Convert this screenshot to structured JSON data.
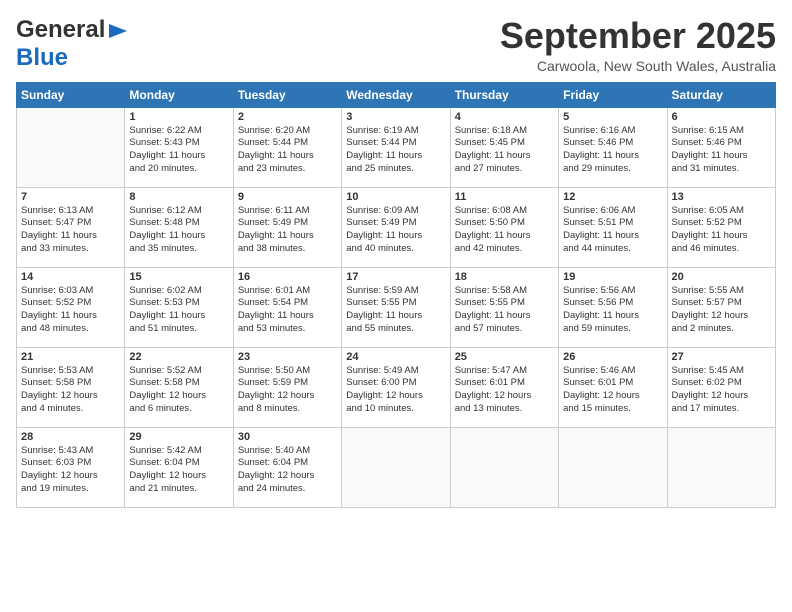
{
  "logo": {
    "line1": "General",
    "line2": "Blue"
  },
  "title": "September 2025",
  "subtitle": "Carwoola, New South Wales, Australia",
  "days": [
    "Sunday",
    "Monday",
    "Tuesday",
    "Wednesday",
    "Thursday",
    "Friday",
    "Saturday"
  ],
  "weeks": [
    [
      {
        "num": "",
        "lines": []
      },
      {
        "num": "1",
        "lines": [
          "Sunrise: 6:22 AM",
          "Sunset: 5:43 PM",
          "Daylight: 11 hours",
          "and 20 minutes."
        ]
      },
      {
        "num": "2",
        "lines": [
          "Sunrise: 6:20 AM",
          "Sunset: 5:44 PM",
          "Daylight: 11 hours",
          "and 23 minutes."
        ]
      },
      {
        "num": "3",
        "lines": [
          "Sunrise: 6:19 AM",
          "Sunset: 5:44 PM",
          "Daylight: 11 hours",
          "and 25 minutes."
        ]
      },
      {
        "num": "4",
        "lines": [
          "Sunrise: 6:18 AM",
          "Sunset: 5:45 PM",
          "Daylight: 11 hours",
          "and 27 minutes."
        ]
      },
      {
        "num": "5",
        "lines": [
          "Sunrise: 6:16 AM",
          "Sunset: 5:46 PM",
          "Daylight: 11 hours",
          "and 29 minutes."
        ]
      },
      {
        "num": "6",
        "lines": [
          "Sunrise: 6:15 AM",
          "Sunset: 5:46 PM",
          "Daylight: 11 hours",
          "and 31 minutes."
        ]
      }
    ],
    [
      {
        "num": "7",
        "lines": [
          "Sunrise: 6:13 AM",
          "Sunset: 5:47 PM",
          "Daylight: 11 hours",
          "and 33 minutes."
        ]
      },
      {
        "num": "8",
        "lines": [
          "Sunrise: 6:12 AM",
          "Sunset: 5:48 PM",
          "Daylight: 11 hours",
          "and 35 minutes."
        ]
      },
      {
        "num": "9",
        "lines": [
          "Sunrise: 6:11 AM",
          "Sunset: 5:49 PM",
          "Daylight: 11 hours",
          "and 38 minutes."
        ]
      },
      {
        "num": "10",
        "lines": [
          "Sunrise: 6:09 AM",
          "Sunset: 5:49 PM",
          "Daylight: 11 hours",
          "and 40 minutes."
        ]
      },
      {
        "num": "11",
        "lines": [
          "Sunrise: 6:08 AM",
          "Sunset: 5:50 PM",
          "Daylight: 11 hours",
          "and 42 minutes."
        ]
      },
      {
        "num": "12",
        "lines": [
          "Sunrise: 6:06 AM",
          "Sunset: 5:51 PM",
          "Daylight: 11 hours",
          "and 44 minutes."
        ]
      },
      {
        "num": "13",
        "lines": [
          "Sunrise: 6:05 AM",
          "Sunset: 5:52 PM",
          "Daylight: 11 hours",
          "and 46 minutes."
        ]
      }
    ],
    [
      {
        "num": "14",
        "lines": [
          "Sunrise: 6:03 AM",
          "Sunset: 5:52 PM",
          "Daylight: 11 hours",
          "and 48 minutes."
        ]
      },
      {
        "num": "15",
        "lines": [
          "Sunrise: 6:02 AM",
          "Sunset: 5:53 PM",
          "Daylight: 11 hours",
          "and 51 minutes."
        ]
      },
      {
        "num": "16",
        "lines": [
          "Sunrise: 6:01 AM",
          "Sunset: 5:54 PM",
          "Daylight: 11 hours",
          "and 53 minutes."
        ]
      },
      {
        "num": "17",
        "lines": [
          "Sunrise: 5:59 AM",
          "Sunset: 5:55 PM",
          "Daylight: 11 hours",
          "and 55 minutes."
        ]
      },
      {
        "num": "18",
        "lines": [
          "Sunrise: 5:58 AM",
          "Sunset: 5:55 PM",
          "Daylight: 11 hours",
          "and 57 minutes."
        ]
      },
      {
        "num": "19",
        "lines": [
          "Sunrise: 5:56 AM",
          "Sunset: 5:56 PM",
          "Daylight: 11 hours",
          "and 59 minutes."
        ]
      },
      {
        "num": "20",
        "lines": [
          "Sunrise: 5:55 AM",
          "Sunset: 5:57 PM",
          "Daylight: 12 hours",
          "and 2 minutes."
        ]
      }
    ],
    [
      {
        "num": "21",
        "lines": [
          "Sunrise: 5:53 AM",
          "Sunset: 5:58 PM",
          "Daylight: 12 hours",
          "and 4 minutes."
        ]
      },
      {
        "num": "22",
        "lines": [
          "Sunrise: 5:52 AM",
          "Sunset: 5:58 PM",
          "Daylight: 12 hours",
          "and 6 minutes."
        ]
      },
      {
        "num": "23",
        "lines": [
          "Sunrise: 5:50 AM",
          "Sunset: 5:59 PM",
          "Daylight: 12 hours",
          "and 8 minutes."
        ]
      },
      {
        "num": "24",
        "lines": [
          "Sunrise: 5:49 AM",
          "Sunset: 6:00 PM",
          "Daylight: 12 hours",
          "and 10 minutes."
        ]
      },
      {
        "num": "25",
        "lines": [
          "Sunrise: 5:47 AM",
          "Sunset: 6:01 PM",
          "Daylight: 12 hours",
          "and 13 minutes."
        ]
      },
      {
        "num": "26",
        "lines": [
          "Sunrise: 5:46 AM",
          "Sunset: 6:01 PM",
          "Daylight: 12 hours",
          "and 15 minutes."
        ]
      },
      {
        "num": "27",
        "lines": [
          "Sunrise: 5:45 AM",
          "Sunset: 6:02 PM",
          "Daylight: 12 hours",
          "and 17 minutes."
        ]
      }
    ],
    [
      {
        "num": "28",
        "lines": [
          "Sunrise: 5:43 AM",
          "Sunset: 6:03 PM",
          "Daylight: 12 hours",
          "and 19 minutes."
        ]
      },
      {
        "num": "29",
        "lines": [
          "Sunrise: 5:42 AM",
          "Sunset: 6:04 PM",
          "Daylight: 12 hours",
          "and 21 minutes."
        ]
      },
      {
        "num": "30",
        "lines": [
          "Sunrise: 5:40 AM",
          "Sunset: 6:04 PM",
          "Daylight: 12 hours",
          "and 24 minutes."
        ]
      },
      {
        "num": "",
        "lines": []
      },
      {
        "num": "",
        "lines": []
      },
      {
        "num": "",
        "lines": []
      },
      {
        "num": "",
        "lines": []
      }
    ]
  ]
}
